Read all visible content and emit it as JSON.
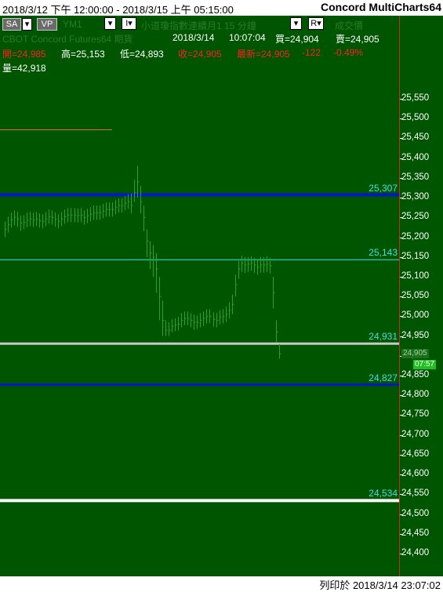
{
  "window": {
    "range_text": "2018/3/12 下午 12:00:00 - 2018/3/15 上午 05:15:00",
    "app_title": "Concord MultiCharts64"
  },
  "toolbar": {
    "sa_label": "SA",
    "vp_label": "VP",
    "symbol_label": "YM1",
    "description": "小道瓊指數連續月1 15 分鐘",
    "type_label": "成交價",
    "exchange_label": "CBOT Concord Futures64 期貨",
    "chart_date": "2018/3/14",
    "chart_time": "10:07:04",
    "bid": "買=24,904",
    "ask": "賣=24,905"
  },
  "quote": {
    "open": "開=24,985",
    "high": "高=25,153",
    "low": "低=24,893",
    "close": "收=24,905",
    "last": "最新=24,905",
    "change": "-122",
    "change_pct": "-0.49%",
    "volume": "量=42,918"
  },
  "colors": {
    "background": "#005500",
    "bars": "#2fa02f",
    "price_red": "#ff2020",
    "level_label": "#3ee0e0",
    "blue_line": "#0018c8",
    "cyan_line": "#3ee0e0"
  },
  "levels": [
    {
      "value": 25307,
      "label": "25,307",
      "color": "#0018c8",
      "thickness": 4
    },
    {
      "value": 25143,
      "label": "25,143",
      "color": "#3ee0e0",
      "thickness": 1
    },
    {
      "value": 24931,
      "label": "24,931",
      "color": "#c8c8c8",
      "thickness": 3
    },
    {
      "value": 24827,
      "label": "24,827",
      "color": "#0018c8",
      "thickness": 3
    },
    {
      "value": 24534,
      "label": "24,534",
      "color": "#ffffff",
      "thickness": 4
    }
  ],
  "y_ticks": [
    "25,550",
    "25,500",
    "25,450",
    "25,400",
    "25,350",
    "25,300",
    "25,250",
    "25,200",
    "25,150",
    "25,100",
    "25,050",
    "25,000",
    "24,950",
    "24,900",
    "24,850",
    "24,800",
    "24,750",
    "24,700",
    "24,650",
    "24,600",
    "24,550",
    "24,500",
    "24,450",
    "24,400"
  ],
  "current_price_label": "24,905",
  "countdown_label": "07:57",
  "footer": {
    "printed_at": "列印於 2018/3/14 23:07:02"
  },
  "chart_data": {
    "type": "ohlc",
    "title": "",
    "series": [
      {
        "name": "YM1",
        "close": [
          25220,
          25232,
          25244,
          25250,
          25246,
          25236,
          25238,
          25244,
          25246,
          25244,
          25246,
          25242,
          25240,
          25246,
          25252,
          25250,
          25245,
          25240,
          25246,
          25252,
          25256,
          25256,
          25256,
          25255,
          25256,
          25250,
          25254,
          25258,
          25262,
          25262,
          25262,
          25266,
          25270,
          25270,
          25270,
          25276,
          25280,
          25280,
          25286,
          25290,
          25280,
          25312,
          25340,
          25290,
          25250,
          25190,
          25160,
          25150,
          25120,
          25050,
          24990,
          24965,
          24965,
          24975,
          24978,
          24980,
          24990,
          24995,
          24995,
          24990,
          24985,
          24985,
          24990,
          24995,
          25000,
          25000,
          24992,
          24990,
          24998,
          25000,
          25005,
          25015,
          25030,
          25080,
          25120,
          25135,
          25130,
          25132,
          25135,
          25130,
          25125,
          25130,
          25130,
          25132,
          25128,
          25060,
          24960,
          24905
        ],
        "lows": [
          25200,
          25212,
          25224,
          25230,
          25226,
          25216,
          25220,
          25225,
          25228,
          25226,
          25228,
          25224,
          25222,
          25228,
          25234,
          25232,
          25227,
          25222,
          25228,
          25234,
          25238,
          25238,
          25238,
          25237,
          25238,
          25232,
          25236,
          25240,
          25244,
          25244,
          25244,
          25248,
          25252,
          25252,
          25252,
          25258,
          25262,
          25262,
          25268,
          25272,
          25260,
          25290,
          25300,
          25260,
          25215,
          25150,
          25120,
          25100,
          25060,
          24990,
          24950,
          24950,
          24950,
          24960,
          24962,
          24964,
          24972,
          24978,
          24978,
          24972,
          24966,
          24968,
          24972,
          24976,
          24982,
          24982,
          24974,
          24972,
          24980,
          24982,
          24986,
          24995,
          25005,
          25050,
          25095,
          25112,
          25110,
          25112,
          25115,
          25110,
          25105,
          25110,
          25110,
          25112,
          25108,
          25020,
          24935,
          24893
        ],
        "highs": [
          25240,
          25252,
          25262,
          25268,
          25264,
          25255,
          25256,
          25262,
          25264,
          25262,
          25264,
          25260,
          25258,
          25264,
          25270,
          25268,
          25263,
          25258,
          25264,
          25270,
          25274,
          25274,
          25274,
          25273,
          25274,
          25268,
          25272,
          25276,
          25280,
          25280,
          25280,
          25284,
          25288,
          25288,
          25288,
          25294,
          25298,
          25298,
          25304,
          25308,
          25310,
          25345,
          25380,
          25330,
          25280,
          25220,
          25190,
          25180,
          25160,
          25100,
          25040,
          24990,
          24985,
          24992,
          24995,
          24998,
          25008,
          25012,
          25012,
          25008,
          25004,
          25002,
          25008,
          25012,
          25018,
          25018,
          25010,
          25008,
          25016,
          25018,
          25024,
          25035,
          25055,
          25105,
          25140,
          25153,
          25150,
          25150,
          25152,
          25148,
          25145,
          25150,
          25150,
          25152,
          25148,
          25100,
          24990,
          24930
        ]
      }
    ],
    "ylabel": "",
    "ylim": [
      24375,
      25600
    ],
    "grid": false,
    "legend": "none"
  }
}
